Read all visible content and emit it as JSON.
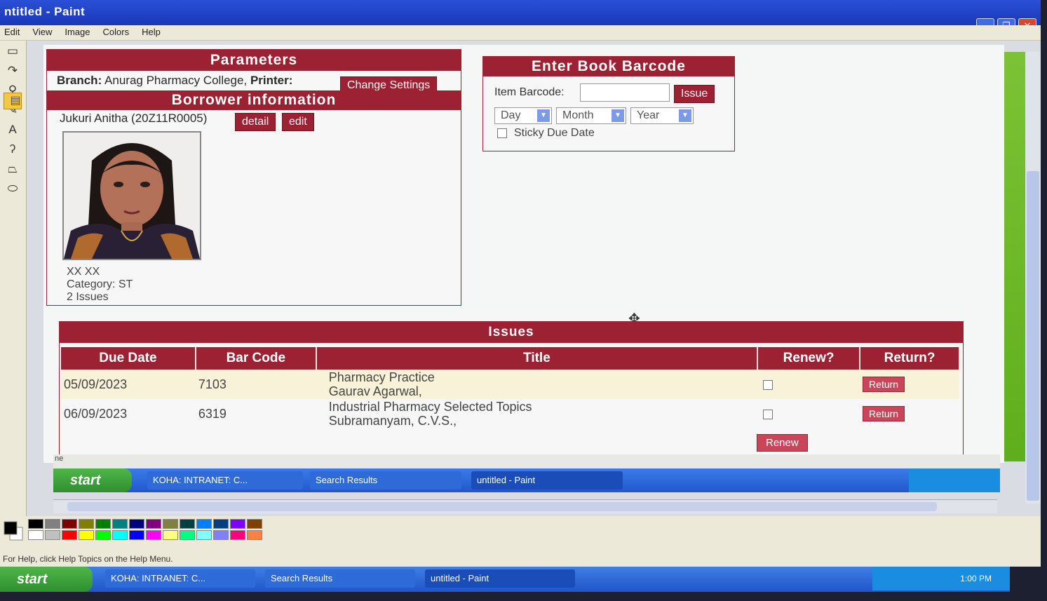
{
  "window": {
    "title": "ntitled - Paint",
    "menu": [
      "Edit",
      "View",
      "Image",
      "Colors",
      "Help"
    ]
  },
  "parameters": {
    "heading": "Parameters",
    "branch_label": "Branch:",
    "branch_value": "Anurag Pharmacy College,",
    "printer_label": "Printer:",
    "change_settings": "Change Settings",
    "borrower_heading": "Borrower information",
    "patron_name": "Jukuri Anitha (20Z11R0005)",
    "detail_label": "detail",
    "edit_label": "edit",
    "patron_line1": "XX XX",
    "patron_category": "Category: ST",
    "patron_issues": "2 Issues"
  },
  "barcode": {
    "heading": "Enter Book Barcode",
    "item_label": "Item Barcode:",
    "item_value": "",
    "issue_label": "Issue",
    "day": "Day",
    "month": "Month",
    "year": "Year",
    "sticky_label": "Sticky Due Date"
  },
  "issues": {
    "heading": "Issues",
    "columns": [
      "Due Date",
      "Bar Code",
      "Title",
      "Renew?",
      "Return?"
    ],
    "rows": [
      {
        "due": "05/09/2023",
        "barcode": "7103",
        "title": "Pharmacy Practice",
        "author": "Gaurav Agarwal,",
        "return_label": "Return"
      },
      {
        "due": "06/09/2023",
        "barcode": "6319",
        "title": "Industrial Pharmacy Selected Topics",
        "author": "Subramanyam, C.V.S.,",
        "return_label": "Return"
      }
    ],
    "renew_label": "Renew"
  },
  "inner_status": "ne",
  "inner_taskbar": {
    "start": "start",
    "tasks": [
      "KOHA: INTRANET: C...",
      "Search Results",
      "untitled - Paint"
    ]
  },
  "status_text": "For Help, click Help Topics on the Help Menu.",
  "taskbar": {
    "start": "start",
    "tasks": [
      "KOHA: INTRANET: C...",
      "Search Results",
      "untitled - Paint"
    ],
    "clock": "1:00 PM"
  },
  "palette": [
    "#000000",
    "#808080",
    "#800000",
    "#808000",
    "#008000",
    "#008080",
    "#000080",
    "#800080",
    "#808040",
    "#004040",
    "#0080ff",
    "#004080",
    "#8000ff",
    "#804000",
    "#ffffff",
    "#c0c0c0",
    "#ff0000",
    "#ffff00",
    "#00ff00",
    "#00ffff",
    "#0000ff",
    "#ff00ff",
    "#ffff80",
    "#00ff80",
    "#80ffff",
    "#8080ff",
    "#ff0080",
    "#ff8040"
  ],
  "colors": {
    "accent": "#9b2133",
    "link": "#3a5fcd"
  }
}
